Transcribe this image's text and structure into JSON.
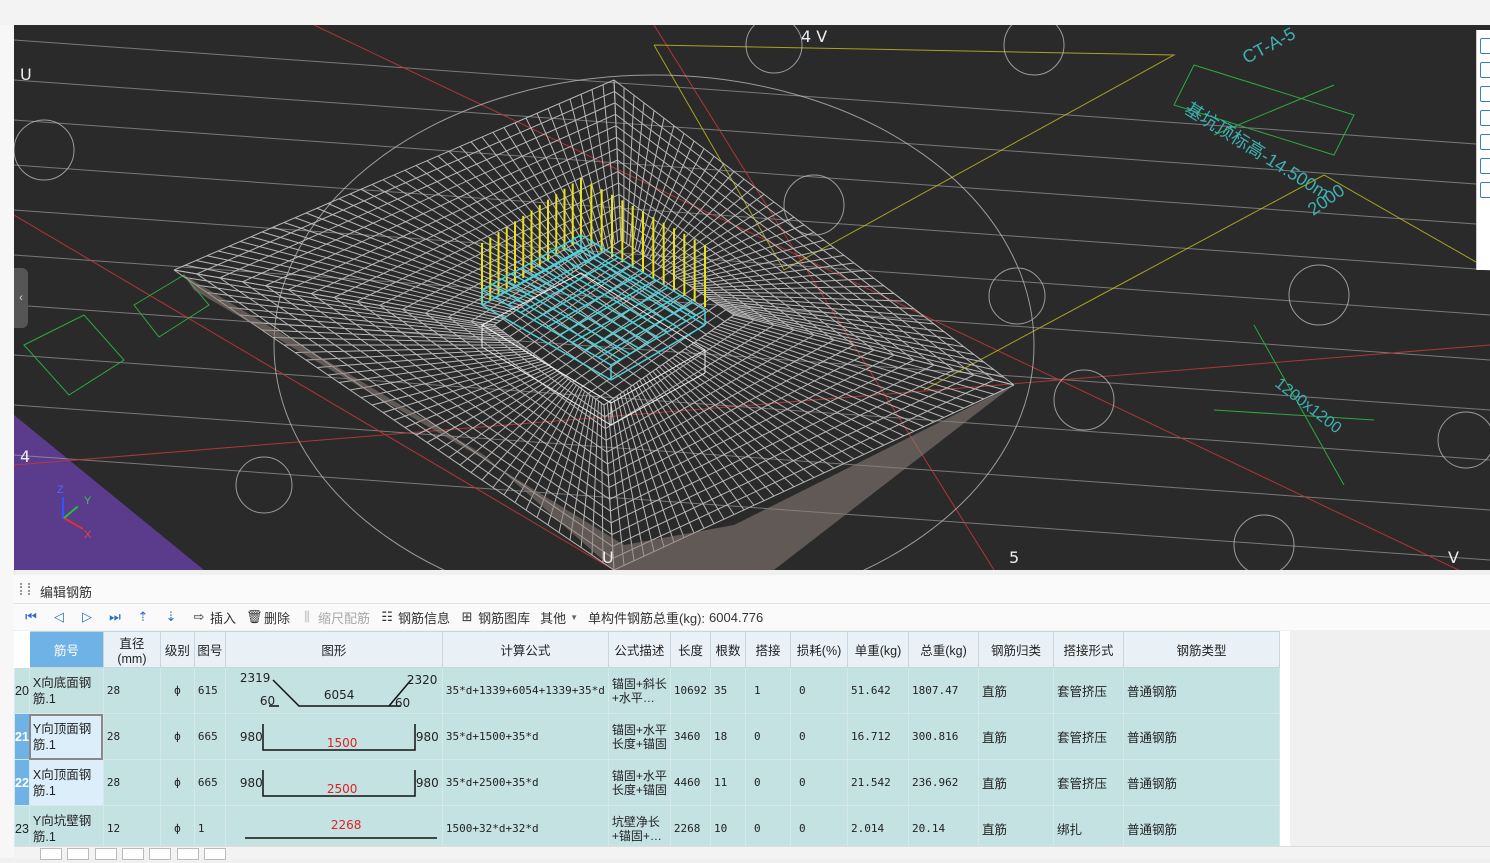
{
  "viewport": {
    "axis_labels": {
      "u_top": "U",
      "u_bottom": "U",
      "v_top": "4 V",
      "v_bottom": "V",
      "four_left": "4",
      "five_bottom": "5"
    },
    "annotations": {
      "elev": "基坑顶标高-14.500m",
      "tag1": "CT-A-5",
      "dim1": "2000",
      "dim2": "1200x1200"
    },
    "axes_gizmo": {
      "x": "X",
      "y": "Y",
      "z": "Z"
    },
    "colors": {
      "background": "#2a2a2a",
      "rebar_mesh": "#b8b8b8",
      "column_rebar": "#e8e020",
      "top_mesh": "#4fd0d8",
      "grid_line": "#c23a3a",
      "dim_line": "#2fa83f",
      "purple_zone": "#5a3b8c"
    }
  },
  "panel": {
    "title": "编辑钢筋"
  },
  "toolbar": {
    "insert": "插入",
    "delete": "删除",
    "scale": "缩尺配筋",
    "info": "钢筋信息",
    "library": "钢筋图库",
    "other": "其他",
    "total_weight_label": "单构件钢筋总重(kg):",
    "total_weight_value": "6004.776"
  },
  "table": {
    "headers": [
      "筋号",
      "直径(mm)",
      "级别",
      "图号",
      "图形",
      "计算公式",
      "公式描述",
      "长度",
      "根数",
      "搭接",
      "损耗(%)",
      "单重(kg)",
      "总重(kg)",
      "钢筋归类",
      "搭接形式",
      "钢筋类型"
    ],
    "rows": [
      {
        "num": "20",
        "name": "X向底面钢筋.1",
        "dia": "28",
        "grade": "ф",
        "fig": "615",
        "shape": {
          "a": "2319",
          "b": "6054",
          "c": "2320",
          "d": "60",
          "e": "60"
        },
        "formula": "35*d+1339+6054+1339+35*d",
        "desc": "锚固+斜长+水平…",
        "length": "10692",
        "count": "35",
        "lap": "1",
        "loss": "0",
        "unit_w": "51.642",
        "total_w": "1807.47",
        "category": "直筋",
        "lap_form": "套管挤压",
        "type": "普通钢筋"
      },
      {
        "num": "21",
        "name": "Y向顶面钢筋.1",
        "dia": "28",
        "grade": "ф",
        "fig": "665",
        "shape": {
          "l": "980",
          "m": "1500",
          "r": "980"
        },
        "formula": "35*d+1500+35*d",
        "desc": "锚固+水平长度+锚固",
        "length": "3460",
        "count": "18",
        "lap": "0",
        "loss": "0",
        "unit_w": "16.712",
        "total_w": "300.816",
        "category": "直筋",
        "lap_form": "套管挤压",
        "type": "普通钢筋"
      },
      {
        "num": "22",
        "name": "X向顶面钢筋.1",
        "dia": "28",
        "grade": "ф",
        "fig": "665",
        "shape": {
          "l": "980",
          "m": "2500",
          "r": "980"
        },
        "formula": "35*d+2500+35*d",
        "desc": "锚固+水平长度+锚固",
        "length": "4460",
        "count": "11",
        "lap": "0",
        "loss": "0",
        "unit_w": "21.542",
        "total_w": "236.962",
        "category": "直筋",
        "lap_form": "套管挤压",
        "type": "普通钢筋"
      },
      {
        "num": "23",
        "name": "Y向坑壁钢筋.1",
        "dia": "12",
        "grade": "ф",
        "fig": "1",
        "shape": {
          "m": "2268"
        },
        "formula": "1500+32*d+32*d",
        "desc": "坑壁净长+锚固+…",
        "length": "2268",
        "count": "10",
        "lap": "0",
        "loss": "0",
        "unit_w": "2.014",
        "total_w": "20.14",
        "category": "直筋",
        "lap_form": "绑扎",
        "type": "普通钢筋"
      }
    ]
  }
}
